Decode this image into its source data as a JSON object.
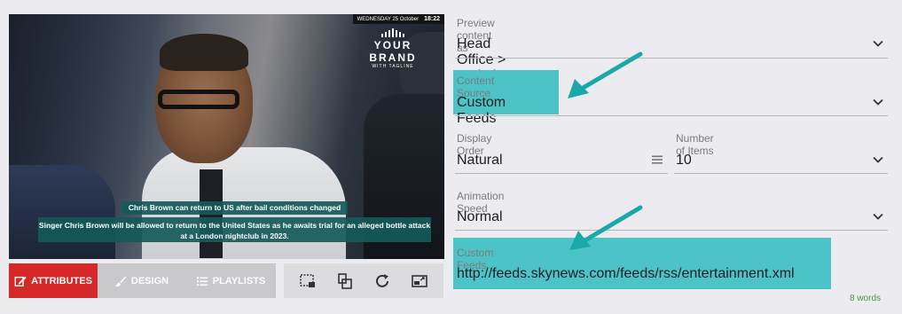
{
  "preview": {
    "date_label": "WEDNESDAY 25 October",
    "time": "18:22",
    "brand_name": "YOUR BRAND",
    "brand_tagline": "WITH TAGLINE",
    "caption_title": "Chris Brown can return to US after bail conditions changed",
    "caption_body": "Singer Chris Brown will be allowed to return to the United States as he awaits trial for an alleged bottle attack at a London nightclub in 2023."
  },
  "toolbar": {
    "attributes_label": "ATTRIBUTES",
    "design_label": "DESIGN",
    "playlists_label": "PLAYLISTS",
    "tools": [
      "select-region-icon",
      "layers-icon",
      "refresh-icon",
      "resize-screen-icon"
    ]
  },
  "form": {
    "preview_as": {
      "label": "Preview content as",
      "value": "Head Office > Webview"
    },
    "content_source": {
      "label": "Content Source",
      "value": "Custom Feeds"
    },
    "display_order": {
      "label": "Display Order",
      "value": "Natural"
    },
    "number_of_items": {
      "label": "Number of Items",
      "value": "10"
    },
    "animation_speed": {
      "label": "Animation Speed",
      "value": "Normal"
    },
    "custom_feeds": {
      "label": "Custom Feeds",
      "value": "http://feeds.skynews.com/feeds/rss/entertainment.xml"
    },
    "word_count": "8 words"
  },
  "colors": {
    "accent_red": "#d62828",
    "highlight_teal": "#4cc3c6",
    "arrow_teal": "#1aa8aa",
    "caption_bg": "#145a5a"
  }
}
